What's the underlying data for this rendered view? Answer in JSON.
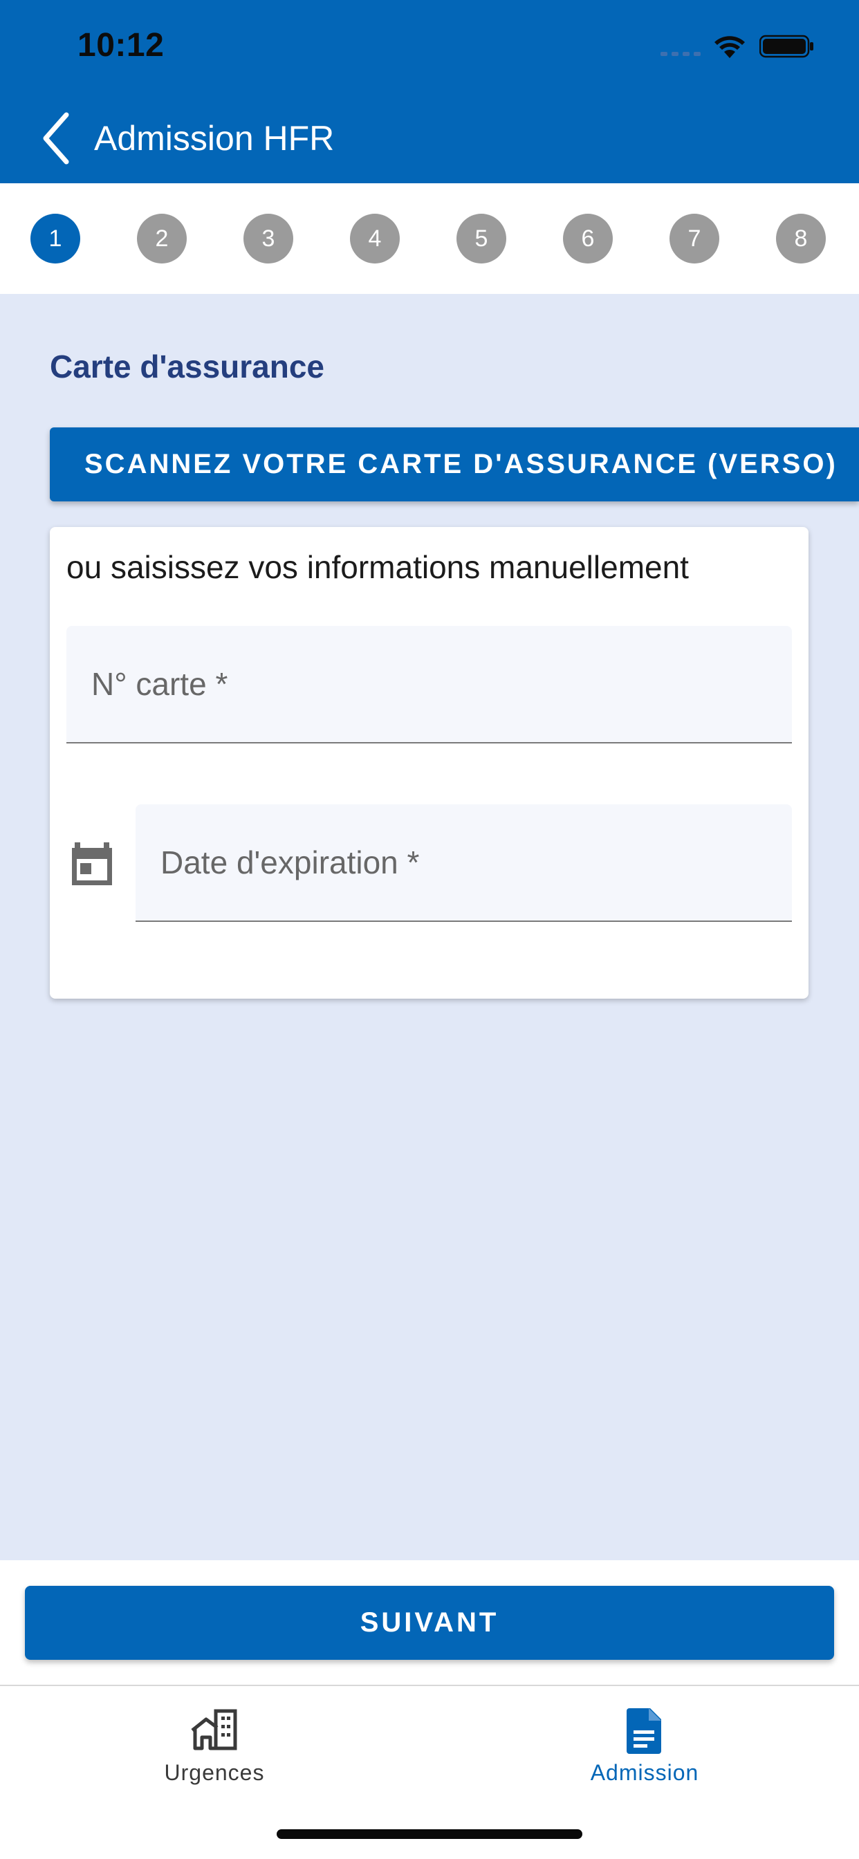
{
  "status_bar": {
    "time": "10:12"
  },
  "app_bar": {
    "title": "Admission HFR"
  },
  "stepper": {
    "steps": [
      "1",
      "2",
      "3",
      "4",
      "5",
      "6",
      "7",
      "8"
    ],
    "active_step": 1,
    "colors": {
      "active": "#0366b7",
      "inactive": "#9b9b9b"
    }
  },
  "section": {
    "title": "Carte d'assurance"
  },
  "scan_button": {
    "label": "SCANNEZ VOTRE CARTE D'ASSURANCE (VERSO)"
  },
  "form_card": {
    "hint": "ou saisissez vos informations manuellement",
    "card_number": {
      "label": "N° carte *",
      "value": ""
    },
    "expiration_date": {
      "label": "Date d'expiration *",
      "value": "",
      "icon": "calendar-icon"
    }
  },
  "next_button": {
    "label": "SUIVANT"
  },
  "tab_bar": {
    "tabs": [
      {
        "label": "Urgences",
        "icon": "hospital-icon",
        "active": false
      },
      {
        "label": "Admission",
        "icon": "document-icon",
        "active": true
      }
    ]
  },
  "theme": {
    "primary": "#0366b7",
    "background": "#e1e8f7",
    "heading": "#243e7e"
  }
}
